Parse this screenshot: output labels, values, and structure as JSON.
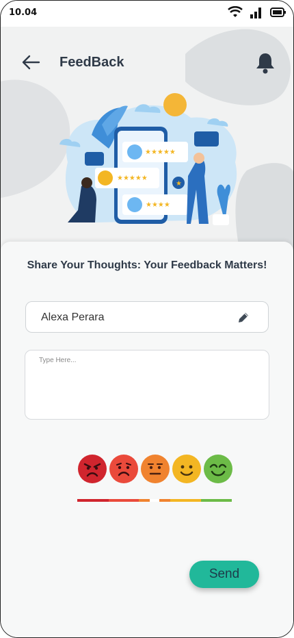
{
  "status_bar": {
    "time": "10.04"
  },
  "header": {
    "title": "FeedBack"
  },
  "form": {
    "heading": "Share Your Thoughts: Your Feedback Matters!",
    "name_value": "Alexa Perara",
    "message_placeholder": "Type Here..."
  },
  "ratings": [
    "very-angry",
    "sad",
    "neutral",
    "happy",
    "very-happy"
  ],
  "colors": {
    "accent": "#21b89a",
    "very_angry": "#d0252e",
    "sad": "#ea4a3b",
    "neutral": "#f0832f",
    "happy": "#f3b623",
    "very_happy": "#6cbb47"
  },
  "send_label": "Send"
}
